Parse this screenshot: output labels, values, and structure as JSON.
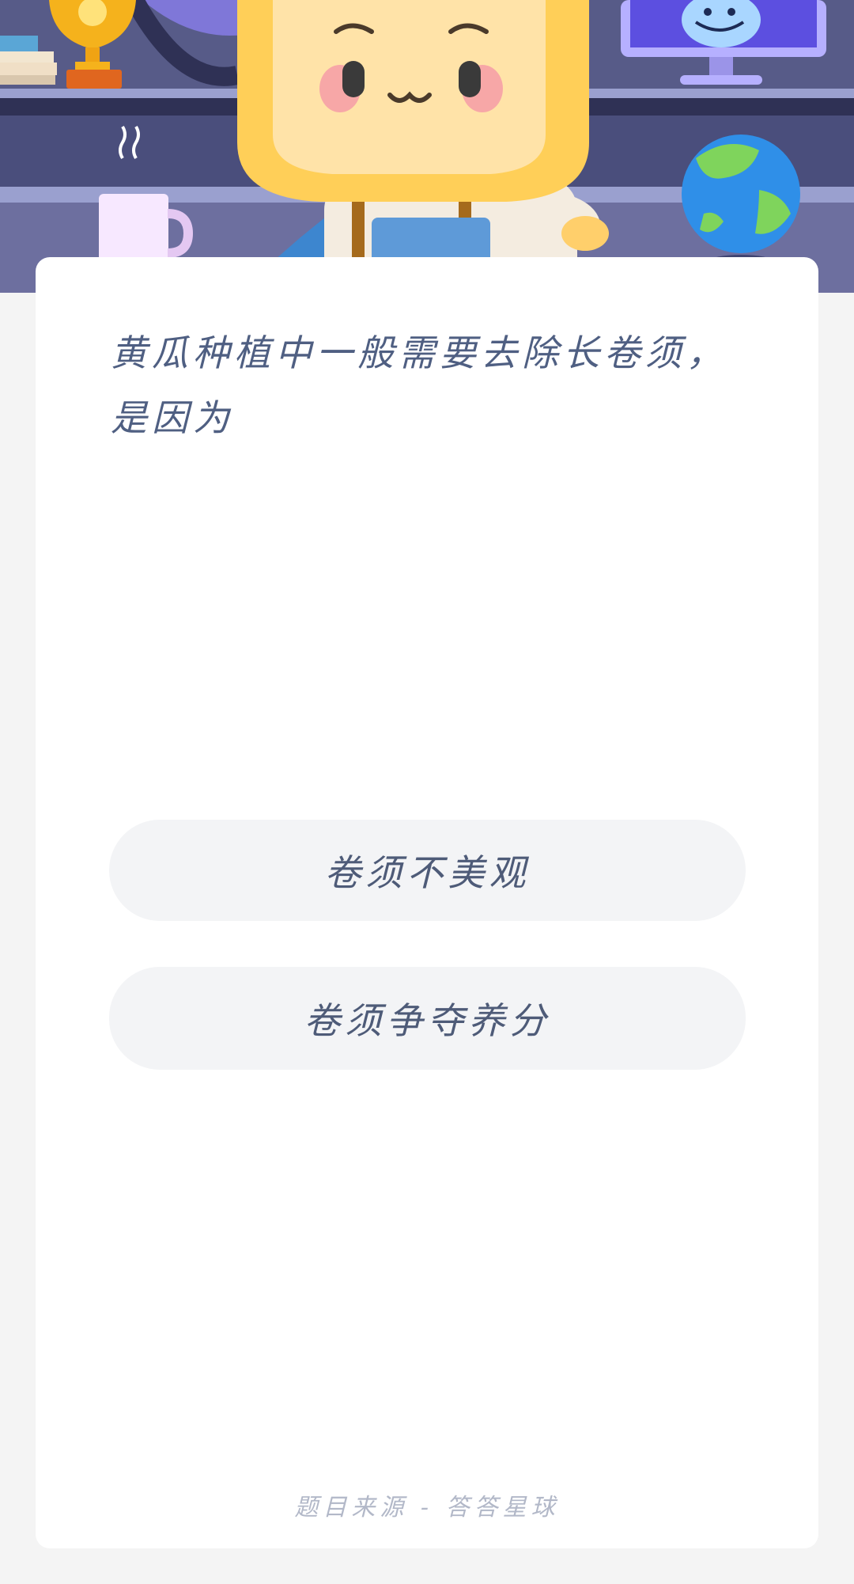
{
  "question": {
    "line1": "黄瓜种植中一般需要去除长卷须，",
    "line2": "是因为"
  },
  "options": [
    {
      "label": "卷须不美观"
    },
    {
      "label": "卷须争夺养分"
    }
  ],
  "footer": {
    "source": "题目来源 - 答答星球"
  },
  "colors": {
    "hero_bg": "#4a4f7a",
    "card_bg": "#ffffff",
    "page_bg": "#f4f4f4",
    "option_bg": "#f3f4f6",
    "text": "#4f5f82"
  },
  "icons": [
    "trophy-icon",
    "mascot-illustration",
    "monitor-icon",
    "globe-icon",
    "coffee-mug-icon",
    "books-icon"
  ]
}
